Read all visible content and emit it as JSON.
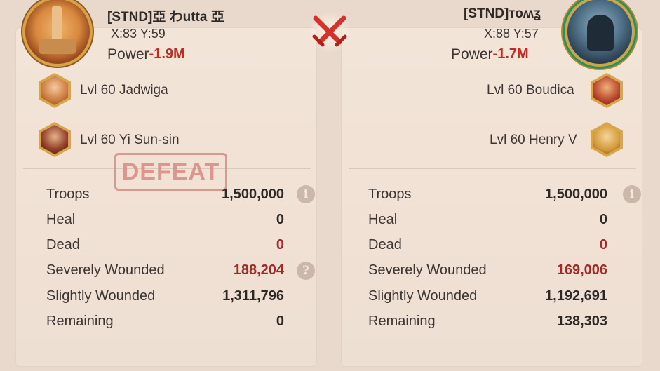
{
  "left": {
    "name": "[STND]亞 わutta 亞",
    "coords": "X:83 Y:59",
    "power_label": "Power",
    "power_value": "-1.9M",
    "heroes": [
      {
        "label": "Lvl 60 Jadwiga",
        "icon": "jadwiga-portrait-icon"
      },
      {
        "label": "Lvl 60 Yi Sun-sin",
        "icon": "yi-sun-sin-portrait-icon"
      }
    ],
    "stamp": "DEFEAT",
    "stats": [
      {
        "label": "Troops",
        "value": "1,500,000"
      },
      {
        "label": "Heal",
        "value": "0"
      },
      {
        "label": "Dead",
        "value": "0"
      },
      {
        "label": "Severely Wounded",
        "value": "188,204"
      },
      {
        "label": "Slightly Wounded",
        "value": "1,311,796"
      },
      {
        "label": "Remaining",
        "value": "0"
      }
    ]
  },
  "right": {
    "name": "[STND]тоʍʓ",
    "coords": "X:88 Y:57",
    "power_label": "Power",
    "power_value": "-1.7M",
    "heroes": [
      {
        "label": "Lvl 60 Boudica",
        "icon": "boudica-portrait-icon"
      },
      {
        "label": "Lvl 60 Henry V",
        "icon": "henry-v-portrait-icon"
      }
    ],
    "stats": [
      {
        "label": "Troops",
        "value": "1,500,000"
      },
      {
        "label": "Heal",
        "value": "0"
      },
      {
        "label": "Dead",
        "value": "0"
      },
      {
        "label": "Severely Wounded",
        "value": "169,006"
      },
      {
        "label": "Slightly Wounded",
        "value": "1,192,691"
      },
      {
        "label": "Remaining",
        "value": "138,303"
      }
    ]
  },
  "info_glyph": "i",
  "help_glyph": "?",
  "colors": {
    "loss_red": "#c22b20",
    "dark_red_value": "#a12a24",
    "stamp": "#d98883",
    "panel": "#f1e1d5"
  }
}
